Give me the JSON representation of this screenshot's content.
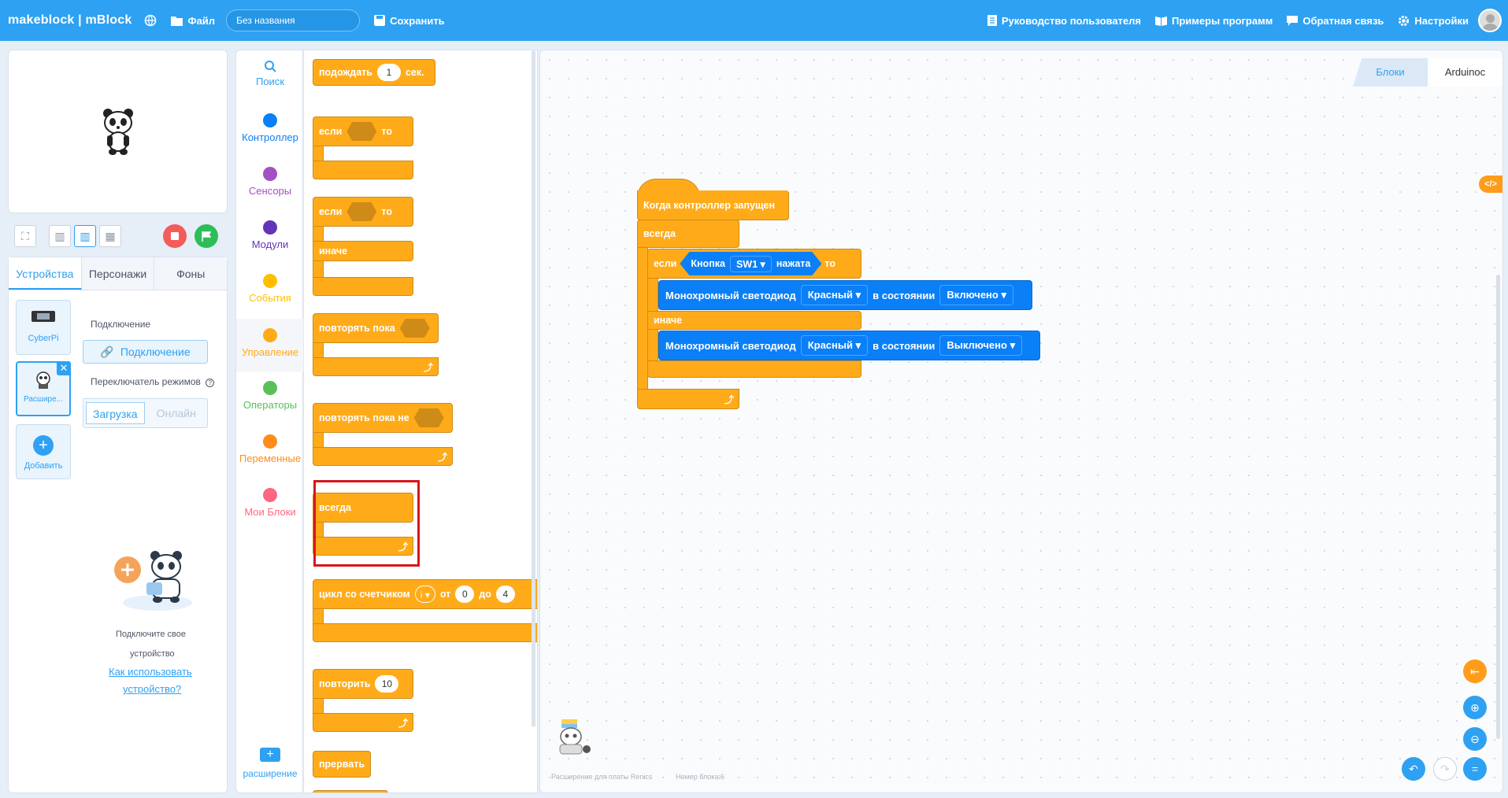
{
  "topbar": {
    "logo": "makeblock | mBlock",
    "file_label": "Файл",
    "project_title": "Без названия",
    "save_label": "Сохранить",
    "guide_label": "Руководство пользователя",
    "examples_label": "Примеры программ",
    "feedback_label": "Обратная связь",
    "settings_label": "Настройки"
  },
  "device_panel": {
    "tabs": [
      "Устройства",
      "Персонажи",
      "Фоны"
    ],
    "devices": [
      {
        "name": "CyberPi"
      },
      {
        "name": "Расшире..."
      }
    ],
    "add_label": "Добавить",
    "connection_label": "Подключение",
    "connect_button": "Подключение",
    "mode_switch_label": "Переключатель режимов",
    "mode_upload": "Загрузка",
    "mode_live": "Онлайн",
    "hint_line1": "Подключите свое",
    "hint_line2": "устройство",
    "howto_link_1": "Как использовать",
    "howto_link_2": "устройство?"
  },
  "categories": [
    {
      "label": "Поиск",
      "color": "#2ea1f2"
    },
    {
      "label": "Контроллер",
      "color": "#0a7ff7"
    },
    {
      "label": "Сенсоры",
      "color": "#a44fc4"
    },
    {
      "label": "Модули",
      "color": "#6434b8"
    },
    {
      "label": "События",
      "color": "#ffbf00"
    },
    {
      "label": "Управление",
      "color": "#ffab19"
    },
    {
      "label": "Операторы",
      "color": "#59c059"
    },
    {
      "label": "Переменные",
      "color": "#ff8c1a"
    },
    {
      "label": "Мои Блоки",
      "color": "#ff6680"
    }
  ],
  "extension_label": "расширение",
  "palette": {
    "wait": {
      "label": "подождать",
      "value": "1",
      "unit": "сек."
    },
    "if": {
      "label": "если",
      "then": "то"
    },
    "if_else": {
      "label": "если",
      "then": "то",
      "else": "иначе"
    },
    "repeat_until": {
      "label": "повторять пока"
    },
    "repeat_until_not": {
      "label": "повторять пока не"
    },
    "forever": {
      "label": "всегда"
    },
    "count_loop": {
      "label": "цикл со счетчиком",
      "var": "i",
      "from": "от",
      "from_val": "0",
      "to": "до",
      "to_val": "4"
    },
    "repeat": {
      "label": "повторить",
      "value": "10"
    },
    "break": {
      "label": "прервать"
    }
  },
  "workspace": {
    "tab_blocks": "Блоки",
    "tab_code": "Arduinoc",
    "hat_label": "Когда контроллер запущен",
    "forever_label": "всегда",
    "if_label": "если",
    "button_label": "Кнопка",
    "button_value": "SW1",
    "pressed_label": "нажата",
    "then_label": "то",
    "else_label": "иначе",
    "led1": {
      "label": "Монохромный светодиод",
      "color": "Красный",
      "state_label": "в состоянии",
      "state": "Включено"
    },
    "led2": {
      "label": "Монохромный светодиод",
      "color": "Красный",
      "state_label": "в состоянии",
      "state": "Выключено"
    },
    "footer_ext": "Расширение для платы Renics",
    "footer_block": "Номер блока:6"
  }
}
